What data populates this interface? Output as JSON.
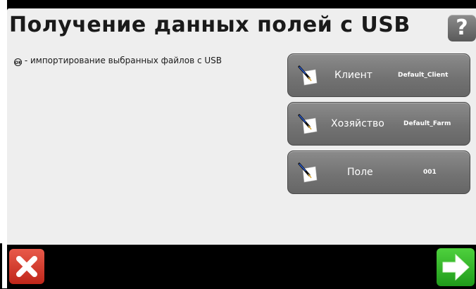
{
  "header": {
    "title": "Получение данных полей с USB",
    "help_label": "?"
  },
  "instruction": {
    "icon": "ok-icon",
    "icon_text": "OK",
    "text": "- импортирование выбранных файлов с USB"
  },
  "fields": [
    {
      "label": "Клиент",
      "value": "Default_Client",
      "icon": "edit-note-icon"
    },
    {
      "label": "Хозяйство",
      "value": "Default_Farm",
      "icon": "edit-note-icon"
    },
    {
      "label": "Поле",
      "value": "001",
      "icon": "edit-note-icon"
    }
  ],
  "footer": {
    "cancel_icon": "close-icon",
    "next_icon": "arrow-right-icon"
  },
  "colors": {
    "panel_bg": "#eeeeee",
    "button_gray": "#777777",
    "cancel_red": "#d63a2b",
    "next_green": "#34b82b"
  }
}
